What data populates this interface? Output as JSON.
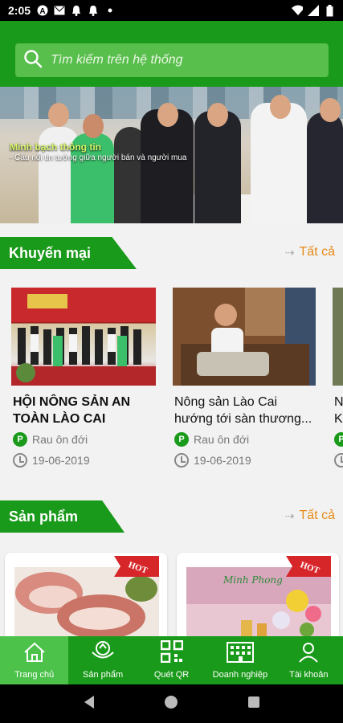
{
  "status_bar": {
    "time": "2:05"
  },
  "search": {
    "placeholder": "Tìm kiếm trên hệ thống"
  },
  "banner": {
    "caption_title": "Minh bạch thông tin",
    "caption_sub": "- Cầu nối tin tưởng giữa người bán và người mua"
  },
  "promotions": {
    "title": "Khuyến mại",
    "see_all": "Tất cả",
    "items": [
      {
        "title_line1": "HỘI NÔNG SẢN AN",
        "title_line2": "TOÀN LÀO CAI",
        "seller": "Rau ôn đới",
        "date": "19-06-2019"
      },
      {
        "title_line1": "Nông sản Lào Cai",
        "title_line2": "hướng tới sàn thương...",
        "seller": "Rau ôn đới",
        "date": "19-06-2019"
      },
      {
        "title_line1": "N",
        "title_line2": "K"
      }
    ]
  },
  "products": {
    "title": "Sản phẩm",
    "see_all": "Tất cả",
    "hot_label": "HOT",
    "sign_text": "Minh Phong"
  },
  "bottom_nav": [
    {
      "label": "Trang chủ",
      "icon": "home-icon"
    },
    {
      "label": "Sản phẩm",
      "icon": "basket-icon"
    },
    {
      "label": "Quét QR",
      "icon": "qr-code-icon"
    },
    {
      "label": "Doanh nghiệp",
      "icon": "building-icon"
    },
    {
      "label": "Tài khoản",
      "icon": "user-icon"
    }
  ],
  "colors": {
    "primary": "#1a9a1a",
    "accent": "#e78a17",
    "active_tab": "#4cc24a"
  }
}
